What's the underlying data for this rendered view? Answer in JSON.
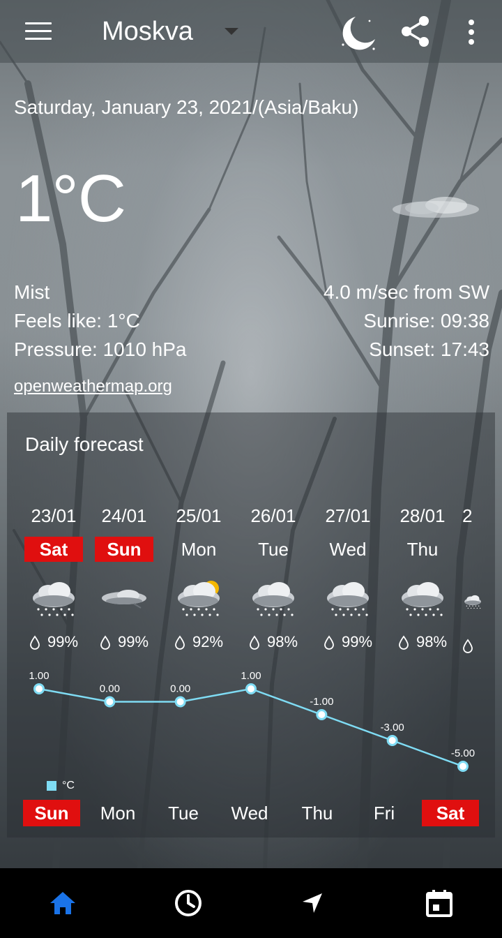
{
  "header": {
    "city": "Moskva",
    "icons": [
      "menu-icon",
      "chevron-down-icon",
      "night-mode-icon",
      "share-icon",
      "more-vert-icon"
    ]
  },
  "current": {
    "date_line": "Saturday, January 23, 2021/(Asia/Baku)",
    "temperature": "1°C",
    "condition": "Mist",
    "feels_like": "Feels like: 1°C",
    "pressure": "Pressure: 1010 hPa",
    "wind": "4.0 m/sec from SW",
    "sunrise": "Sunrise: 09:38",
    "sunset": "Sunset: 17:43",
    "source_link": "openweathermap.org"
  },
  "forecast": {
    "title": "Daily forecast",
    "days": [
      {
        "date": "23/01",
        "name": "Sat",
        "weekend": true,
        "icon": "snow-cloud-icon",
        "precip": "99%"
      },
      {
        "date": "24/01",
        "name": "Sun",
        "weekend": true,
        "icon": "mist-cloud-icon",
        "precip": "99%"
      },
      {
        "date": "25/01",
        "name": "Mon",
        "weekend": false,
        "icon": "sun-snow-cloud-icon",
        "precip": "92%"
      },
      {
        "date": "26/01",
        "name": "Tue",
        "weekend": false,
        "icon": "snow-cloud-icon",
        "precip": "98%"
      },
      {
        "date": "27/01",
        "name": "Wed",
        "weekend": false,
        "icon": "snow-cloud-icon",
        "precip": "99%"
      },
      {
        "date": "28/01",
        "name": "Thu",
        "weekend": false,
        "icon": "snow-cloud-icon",
        "precip": "98%"
      },
      {
        "date": "2",
        "name": "",
        "weekend": false,
        "icon": "snow-cloud-icon",
        "precip": ""
      }
    ]
  },
  "chart_data": {
    "type": "line",
    "categories": [
      "Sun",
      "Mon",
      "Tue",
      "Wed",
      "Thu",
      "Fri",
      "Sat"
    ],
    "weekend": [
      true,
      false,
      false,
      false,
      false,
      false,
      true
    ],
    "series": [
      {
        "name": "°C",
        "values": [
          1.0,
          0.0,
          0.0,
          1.0,
          -1.0,
          -3.0,
          -5.0
        ]
      }
    ],
    "value_labels": [
      "1.00",
      "0.00",
      "0.00",
      "1.00",
      "-1.00",
      "-3.00",
      "-5.00"
    ],
    "legend_position": "bottom-left",
    "line_color": "#7fdcf4"
  },
  "bottom_nav": {
    "items": [
      {
        "name": "home",
        "icon": "home-icon",
        "active": true
      },
      {
        "name": "hourly",
        "icon": "clock-icon",
        "active": false
      },
      {
        "name": "location",
        "icon": "navigation-arrow-icon",
        "active": false
      },
      {
        "name": "calendar",
        "icon": "calendar-icon",
        "active": false
      }
    ],
    "active_color": "#1a73e8"
  }
}
